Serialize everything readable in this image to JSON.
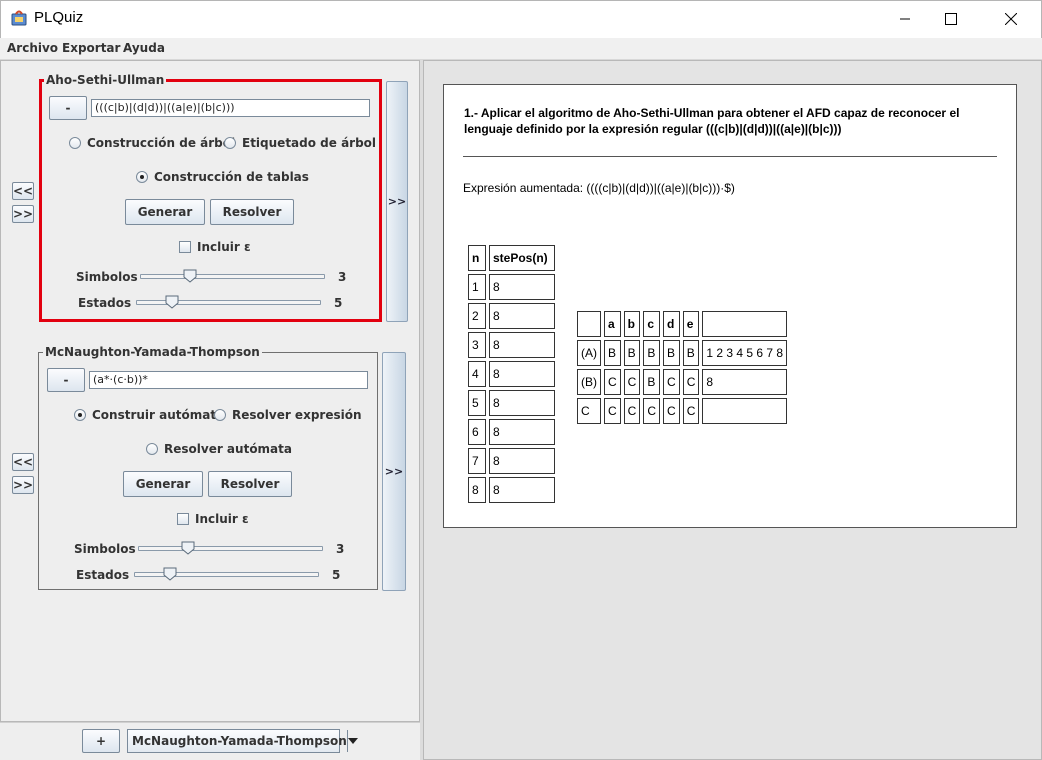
{
  "window": {
    "title": "PLQuiz"
  },
  "menu": [
    "Archivo",
    "Exportar",
    "Ayuda"
  ],
  "panel_ash": {
    "title": "Aho-Sethi-Ullman",
    "minus_label": "-",
    "expression": "(((c|b)|(d|d))|((a|e)|(b|c)))",
    "radio_tree": "Construcción de árbol",
    "radio_label_tree": "Etiquetado de árbol",
    "radio_tables": "Construcción de tablas",
    "generate": "Generar",
    "solve": "Resolver",
    "include_epsilon": "Incluir ε",
    "symbols_label": "Simbolos",
    "symbols_value": "3",
    "symbols_fraction": 0.25,
    "states_label": "Estados",
    "states_value": "5",
    "states_fraction": 0.17,
    "nav_prev": "<<",
    "nav_next": ">>",
    "side_next": ">>"
  },
  "panel_mcyt": {
    "title": "McNaughton-Yamada-Thompson",
    "minus_label": "-",
    "expression": "(a*·(c·b))*",
    "radio_build": "Construir autómata",
    "radio_solve_expr": "Resolver expresión",
    "radio_solve_auto": "Resolver autómata",
    "generate": "Generar",
    "solve": "Resolver",
    "include_epsilon": "Incluir ε",
    "symbols_label": "Simbolos",
    "symbols_value": "3",
    "symbols_fraction": 0.25,
    "states_label": "Estados",
    "states_value": "5",
    "states_fraction": 0.17,
    "nav_prev": "<<",
    "nav_next": ">>",
    "side_next": ">>"
  },
  "bottom": {
    "plus_label": "+",
    "selected_method": "McNaughton-Yamada-Thompson"
  },
  "document": {
    "heading": "1.- Aplicar el algoritmo de Aho-Sethi-Ullman para obtener el AFD capaz de reconocer el lenguaje definido por la expresión regular (((c|b)|(d|d))|((a|e)|(b|c)))",
    "augmented": "Expresión aumentada: ((((c|b)|(d|d))|((a|e)|(b|c)))·$)",
    "stepos_table": {
      "headers": [
        "n",
        "stePos(n)"
      ],
      "rows": [
        [
          "1",
          "8"
        ],
        [
          "2",
          "8"
        ],
        [
          "3",
          "8"
        ],
        [
          "4",
          "8"
        ],
        [
          "5",
          "8"
        ],
        [
          "6",
          "8"
        ],
        [
          "7",
          "8"
        ],
        [
          "8",
          "8"
        ]
      ]
    },
    "transition_table": {
      "headers": [
        "",
        "a",
        "b",
        "c",
        "d",
        "e",
        ""
      ],
      "rows": [
        [
          "(A)",
          "B",
          "B",
          "B",
          "B",
          "B",
          "1 2 3 4 5 6 7 8"
        ],
        [
          "(B)",
          "C",
          "C",
          "B",
          "C",
          "C",
          "8"
        ],
        [
          "C",
          "C",
          "C",
          "C",
          "C",
          "C",
          ""
        ]
      ]
    }
  }
}
